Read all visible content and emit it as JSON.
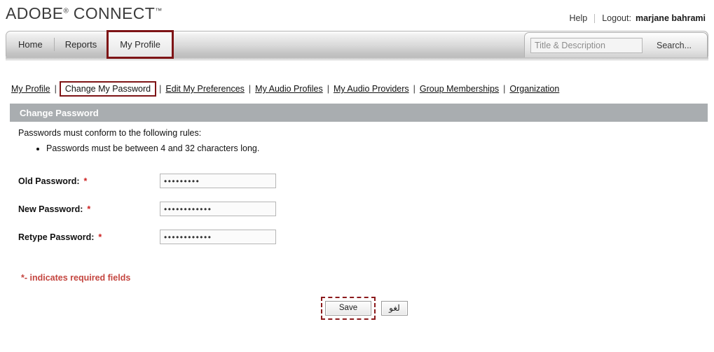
{
  "masthead": {
    "logo_text": "ADOBE",
    "logo_reg": "®",
    "logo_text2": "CONNECT",
    "logo_tm": "™",
    "help_label": "Help",
    "logout_label": "Logout:",
    "user_name": "marjane bahrami"
  },
  "tabs": [
    {
      "label": "Home",
      "active": false,
      "highlighted": false
    },
    {
      "label": "Reports",
      "active": false,
      "highlighted": false
    },
    {
      "label": "My Profile",
      "active": true,
      "highlighted": true
    }
  ],
  "search": {
    "placeholder": "Title & Description",
    "value": "",
    "button_label": "Search..."
  },
  "subnav": {
    "items": [
      {
        "label": "My Profile",
        "current": false
      },
      {
        "label": "Change My Password",
        "current": true
      },
      {
        "label": "Edit My Preferences",
        "current": false
      },
      {
        "label": "My Audio Profiles",
        "current": false
      },
      {
        "label": "My Audio Providers",
        "current": false
      },
      {
        "label": "Group Memberships",
        "current": false
      },
      {
        "label": "Organization",
        "current": false
      }
    ],
    "separator": "|"
  },
  "section": {
    "title": "Change Password"
  },
  "body": {
    "rules_intro": "Passwords must conform to the following rules:",
    "rules": [
      "Passwords must be between 4 and 32 characters long."
    ],
    "required_note": "*- indicates required fields"
  },
  "form": {
    "fields": [
      {
        "label": "Old Password:",
        "star": "*",
        "value": "•••••••••"
      },
      {
        "label": "New Password:",
        "star": "*",
        "value": "••••••••••••"
      },
      {
        "label": "Retype Password:",
        "star": "*",
        "value": "••••••••••••"
      }
    ]
  },
  "buttons": {
    "save_label": "Save",
    "cancel_label": "لغو"
  },
  "colors": {
    "highlight_red": "#7e1416",
    "save_highlight_red": "#8b1a1c",
    "section_bar_gray": "#a9adb0",
    "required_red": "#c4453f",
    "star_red": "#cc2222"
  }
}
